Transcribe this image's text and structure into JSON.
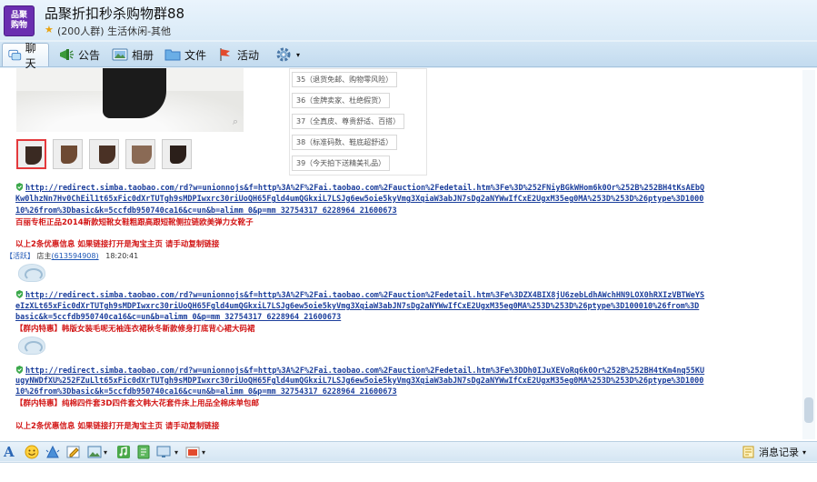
{
  "group": {
    "logo_line1": "品聚",
    "logo_line2": "购物",
    "name": "品聚折扣秒杀购物群88",
    "info": "(200人群) 生活休闲-其他"
  },
  "tabs": [
    {
      "label": "聊天",
      "icon": "chat-icon"
    },
    {
      "label": "公告",
      "icon": "megaphone-icon"
    },
    {
      "label": "相册",
      "icon": "album-icon"
    },
    {
      "label": "文件",
      "icon": "folder-icon"
    },
    {
      "label": "活动",
      "icon": "flag-icon"
    }
  ],
  "settings_icon": "gear-icon",
  "product": {
    "features": [
      "35（退货免邮、购物零风险）",
      "36（金牌卖家、杜绝假货）",
      "37（全真皮、尊贵舒适、百搭）",
      "38（标准码数、鞋底超舒适）",
      "39（今天拍下送精美礼品）"
    ]
  },
  "messages": {
    "m1_link1": "http://redirect.simba.taobao.com/rd?w=unionnojs&f=http%3A%2F%2Fai.taobao.com%2Fauction%2Fedetail.htm%3Fe%3D%252FNiyBGkWHom6k0Or%252B%252BH4tKsAEbQ",
    "m1_link2": "Kw0lhzNn7Hv0ChEil1t65xFic0dXrTUTgh9sMDPIwxrc30riUoQH65Fgld4umQGkxiL7LSJg6ew5oie5kyVmg3XqiaW3abJN7sDg2aNYWwIfCxE2UgxM35eg0MA%253D%253D%26ptype%3D1000",
    "m1_link3": "10%26from%3Dbasic&k=5ccfdb950740ca16&c=un&b=alimm_0&p=mm_32754317_6228964_21600673",
    "m1_text1": "百丽专柜正品2014新款短靴女鞋粗跟高跟短靴侧拉链欧美弹力女靴子",
    "m1_text2": "以上2条优惠信息  如果链接打开是淘宝主页  请手动复制链接",
    "sender_role": "【活跃】",
    "sender_name": "店主",
    "sender_qq": "(613594908)",
    "sender_time": "18:20:41",
    "m2_link1": "http://redirect.simba.taobao.com/rd?w=unionnojs&f=http%3A%2F%2Fai.taobao.com%2Fauction%2Fedetail.htm%3Fe%3DZX4BIX8jU6zebLdhAWchHN9LOX0hRXIzVBTWeYS",
    "m2_link2": "eIzXLt65xFic0dXrTUTgh9sMDPIwxrc30riUoQH65Fgld4umQGkxiL7LSJg6ew5oie5kyVmg3XqiaW3abJN7sDg2aNYWwIfCxE2UgxM35eg0MA%253D%253D%26ptype%3D100010%26from%3D",
    "m2_link3": "basic&k=5ccfdb950740ca16&c=un&b=alimm_0&p=mm_32754317_6228964_21600673",
    "m2_text1": "【群内特惠】韩版女装毛呢无袖连衣裙秋冬新款修身打底背心裙大码裙",
    "m3_link1": "http://redirect.simba.taobao.com/rd?w=unionnojs&f=http%3A%2F%2Fai.taobao.com%2Fauction%2Fedetail.htm%3Fe%3DDh0IJuXEVoRq6k0Or%252B%252BH4tKm4nq55KU",
    "m3_link2": "ugyNWDfXU%252FZuLlt65xFic0dXrTUTgh9sMDPIwxrc30riUoQH65Fgld4umQGkxiL7LSJg6ew5oie5kyVmg3XqiaW3abJN7sDg2aNYWwIfCxE2UgxM35eg0MA%253D%253D%26ptype%3D1000",
    "m3_link3": "10%26from%3Dbasic&k=5ccfdb950740ca16&c=un&b=alimm_0&p=mm_32754317_6228964_21600673",
    "m3_text1": "【群内特惠】纯棉四件套3D四件套文韩大花套件床上用品全棉床单包邮",
    "m3_text2": "以上2条优惠信息  如果链接打开是淘宝主页  请手动复制链接"
  },
  "bottom": {
    "history_label": "消息记录"
  },
  "colors": {
    "link": "#1c3f9c",
    "promo_red": "#d21414",
    "logo_purple": "#6a2eb0"
  }
}
